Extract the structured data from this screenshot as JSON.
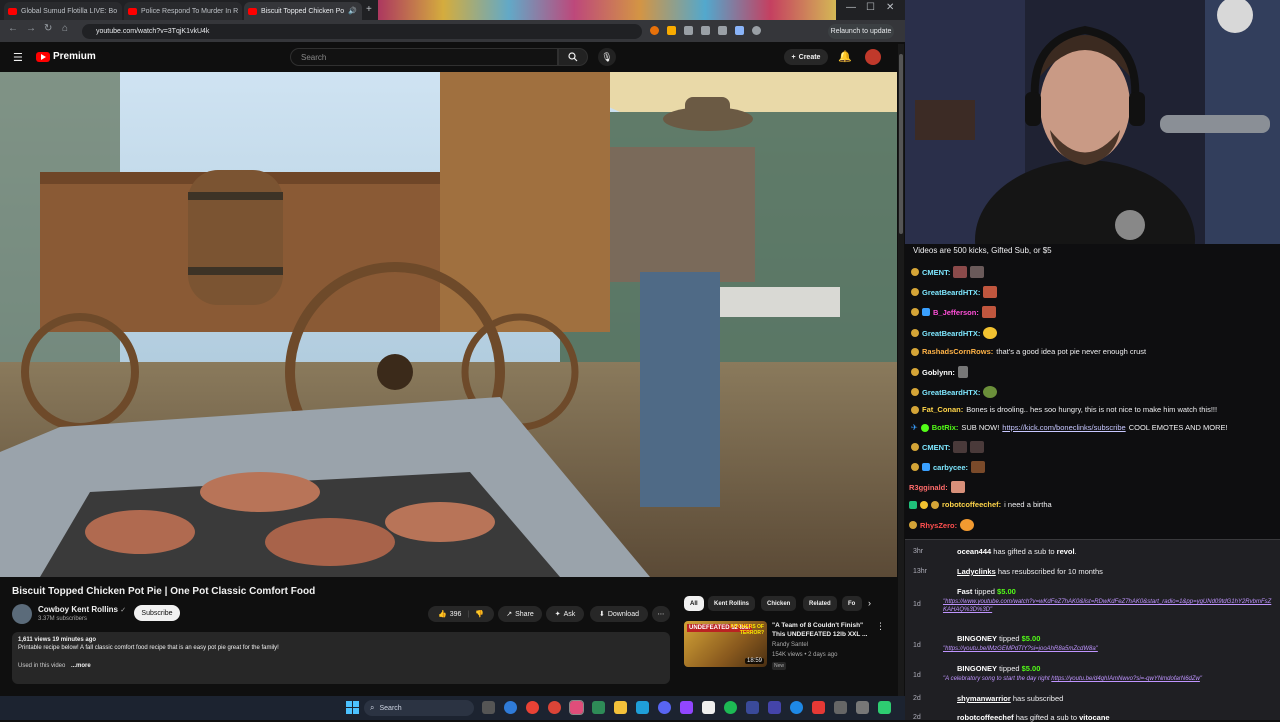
{
  "browser": {
    "tabs": [
      {
        "title": "Global Sumud Flotilla LIVE: Bo"
      },
      {
        "title": "Police Respond To Murder In R"
      },
      {
        "title": "Biscuit Topped Chicken Po"
      }
    ],
    "url": "youtube.com/watch?v=3TqjK1vkU4k",
    "relaunch_label": "Relaunch to update"
  },
  "youtube": {
    "logo_text": "Premium",
    "search_placeholder": "Search",
    "create_label": "Create",
    "video": {
      "title": "Biscuit Topped Chicken Pot Pie | One Pot Classic Comfort Food",
      "channel": "Cowboy Kent Rollins",
      "subscribers": "3.37M subscribers",
      "subscribe_label": "Subscribe",
      "likes": "396",
      "share_label": "Share",
      "ask_label": "Ask",
      "download_label": "Download",
      "views_time": "1,611 views  19 minutes ago",
      "description": "Printable recipe below! A fall classic comfort food recipe that is an easy pot pie great for the family!",
      "description_more_prefix": "Used in this video",
      "more_label": "...more"
    },
    "chips": [
      "All",
      "Kent Rollins",
      "Chicken",
      "Related",
      "Fo"
    ],
    "related": {
      "title": "\"A Team of 8 Couldn't Finish\" This UNDEFEATED 12lb XXL ...",
      "channel": "Randy Santel",
      "views": "154K views • 2 days ago",
      "badge": "New",
      "duration": "18:59",
      "thumb_text": "UNDEFEATED 12 lbs!",
      "thumb_text2": "PITCHERS OF TERROR?"
    }
  },
  "chat": {
    "header": "Videos are 500 kicks, Gifted Sub, or $5",
    "messages": [
      {
        "user": "CMENT:",
        "text": "",
        "color": "#7ee7ff"
      },
      {
        "user": "GreatBeardHTX:",
        "text": "",
        "color": "#7ee7ff"
      },
      {
        "user": "B_Jefferson:",
        "text": "",
        "color": "#ff4fd8"
      },
      {
        "user": "GreatBeardHTX:",
        "text": "",
        "color": "#7ee7ff"
      },
      {
        "user": "RashadsCornRows:",
        "text": "that's a good idea pot pie never enough crust",
        "color": "#ffb347"
      },
      {
        "user": "Goblynn:",
        "text": "",
        "color": "#ffffff"
      },
      {
        "user": "GreatBeardHTX:",
        "text": "",
        "color": "#7ee7ff"
      },
      {
        "user": "Fat_Conan:",
        "text": "Bones is drooling.. hes soo hungry, this is not nice to make him watch this!!!",
        "color": "#ffd54a"
      },
      {
        "user": "BotRix:",
        "text": "SUB NOW! ",
        "link": "https://kick.com/boneclinks/subscribe",
        "text2": " COOL EMOTES AND MORE!",
        "color": "#53fc18"
      },
      {
        "user": "CMENT:",
        "text": "",
        "color": "#7ee7ff"
      },
      {
        "user": "carbycee:",
        "text": "",
        "color": "#7ee7ff"
      },
      {
        "user": "R3gginald:",
        "text": "",
        "color": "#ff6b6b"
      },
      {
        "user": "robotcoffeechef:",
        "text": "i need a birtha",
        "color": "#ffd54a"
      },
      {
        "user": "RhysZero:",
        "text": "",
        "color": "#ff4f4f"
      }
    ]
  },
  "events": [
    {
      "time": "3hr",
      "user": "ocean444",
      "text": " has gifted a sub to ",
      "target": "revol",
      "tail": "."
    },
    {
      "time": "13hr",
      "user": "Ladyclinks",
      "text": " has resubscribed for 10 months"
    },
    {
      "time": "1d",
      "user": "Fast",
      "text": " tipped ",
      "amount": "$5.00",
      "link": "\"https://www.youtube.com/watch?v=wKdFeZ7hAK0&list=RDwKdFeZ7hAK0&start_radio=1&pp=ygUNd09tdG1hY2RvbmFsZKAHAQ%3D%3D\""
    },
    {
      "time": "1d",
      "user": "BINGONEY",
      "text": " tipped ",
      "amount": "$5.00",
      "link": "\"https://youtu.be/lMzGEMPdTIY?si=jooAhR8a5mZcdW8a\""
    },
    {
      "time": "1d",
      "user": "BINGONEY",
      "text": " tipped ",
      "amount": "$5.00",
      "quote": "\"A celebratory song to start the day right ",
      "link": "https://youtu.be/d4ghIAmNwvo?si=-qwYNmdofarN6dZw",
      "quote_end": "\""
    },
    {
      "time": "2d",
      "user": "shymanwarrior",
      "text": " has subscribed"
    },
    {
      "time": "2d",
      "user": "robotcoffeechef",
      "text": " has gifted a sub to ",
      "target": "vitocane"
    }
  ],
  "taskbar": {
    "search_placeholder": "Search"
  }
}
